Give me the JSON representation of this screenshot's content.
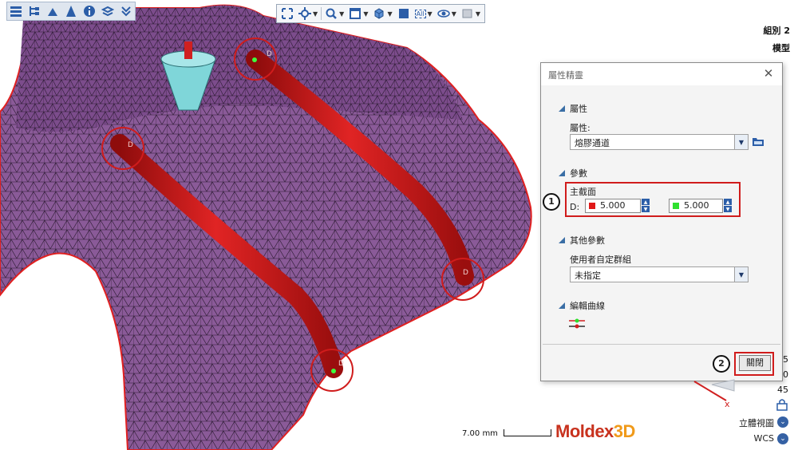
{
  "top_right": {
    "group_label": "組別 2",
    "model_label": "模型"
  },
  "left_toolbar": {
    "icons": [
      "list-icon",
      "tree-icon",
      "mesh-icon",
      "cone-icon",
      "info-icon",
      "layers-icon",
      "collapse-icon"
    ]
  },
  "center_toolbar": {
    "icons": [
      "fit-view-icon",
      "rotate-center-icon",
      "zoom-icon",
      "window-icon",
      "cube-view-icon",
      "fill-icon",
      "all-select-icon",
      "visibility-icon",
      "display-mode-icon"
    ],
    "all_label": "All"
  },
  "dialog": {
    "title": "屬性精靈",
    "section_properties": "屬性",
    "property_label": "屬性:",
    "property_value": "熔膠通道",
    "section_params": "參數",
    "main_section_label": "主截面",
    "d_label": "D:",
    "d_value_1": "5.000",
    "d_value_2": "5.000",
    "section_other": "其他參數",
    "user_group_label": "使用者自定群組",
    "user_group_value": "未指定",
    "section_curve": "編輯曲線",
    "close_button": "關閉",
    "callout_1": "1",
    "callout_2": "2"
  },
  "right_panel": {
    "num1": "5",
    "num2": "0",
    "num3": "45",
    "view_label": "立體視圖",
    "coord_label": "WCS",
    "axis_x": "x"
  },
  "scale_text": "7.00 mm",
  "brand": {
    "main": "Moldex",
    "suffix": "3D"
  },
  "runner_label": "D",
  "colors": {
    "mesh": "#8a5a98",
    "runner": "#d21a1a",
    "cone": "#7fd6d9",
    "accent": "#3a6ea5"
  }
}
